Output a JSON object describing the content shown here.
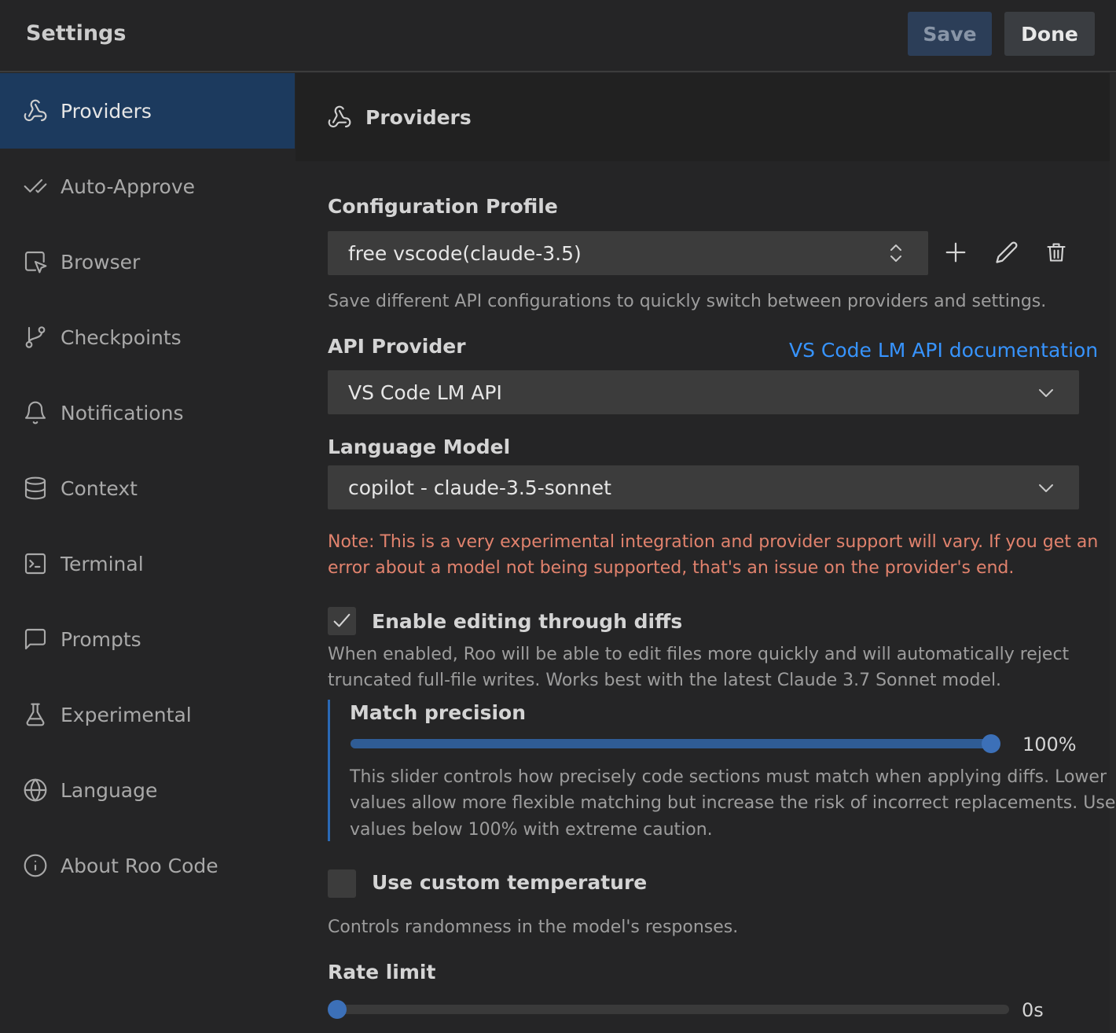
{
  "header": {
    "title": "Settings",
    "save_label": "Save",
    "done_label": "Done"
  },
  "sidebar": {
    "items": [
      {
        "label": "Providers",
        "icon": "webhook-icon",
        "active": true
      },
      {
        "label": "Auto-Approve",
        "icon": "check-check-icon"
      },
      {
        "label": "Browser",
        "icon": "browser-pointer-icon"
      },
      {
        "label": "Checkpoints",
        "icon": "git-branch-icon"
      },
      {
        "label": "Notifications",
        "icon": "bell-icon"
      },
      {
        "label": "Context",
        "icon": "database-icon"
      },
      {
        "label": "Terminal",
        "icon": "terminal-icon"
      },
      {
        "label": "Prompts",
        "icon": "message-square-icon"
      },
      {
        "label": "Experimental",
        "icon": "flask-icon"
      },
      {
        "label": "Language",
        "icon": "globe-icon"
      },
      {
        "label": "About Roo Code",
        "icon": "info-icon"
      }
    ]
  },
  "main": {
    "section_title": "Providers",
    "config_profile": {
      "label": "Configuration Profile",
      "value": "free vscode(claude-3.5)",
      "description": "Save different API configurations to quickly switch between providers and settings."
    },
    "api_provider": {
      "label": "API Provider",
      "doc_link": "VS Code LM API documentation",
      "value": "VS Code LM API"
    },
    "language_model": {
      "label": "Language Model",
      "value": "copilot - claude-3.5-sonnet",
      "note_line1": "Note: This is a very experimental integration and provider support will vary. If you get an",
      "note_line2": "error about a model not being supported, that's an issue on the provider's end."
    },
    "diffs": {
      "label": "Enable editing through diffs",
      "checked": true,
      "desc_line1": "When enabled, Roo will be able to edit files more quickly and will automatically reject",
      "desc_line2": "truncated full-file writes. Works best with the latest Claude 3.7 Sonnet model."
    },
    "match_precision": {
      "label": "Match precision",
      "value": 100,
      "value_text": "100%",
      "desc_line1": "This slider controls how precisely code sections must match when applying diffs. Lower",
      "desc_line2": "values allow more flexible matching but increase the risk of incorrect replacements. Use",
      "desc_line3": "values below 100% with extreme caution."
    },
    "temperature": {
      "label": "Use custom temperature",
      "checked": false,
      "description": "Controls randomness in the model's responses."
    },
    "rate_limit": {
      "label": "Rate limit",
      "value": 0,
      "value_text": "0s"
    }
  },
  "colors": {
    "accent": "#3794ff",
    "active_nav": "#1c3a5e",
    "warning": "#e1826d",
    "slider": "#3c70b8"
  }
}
